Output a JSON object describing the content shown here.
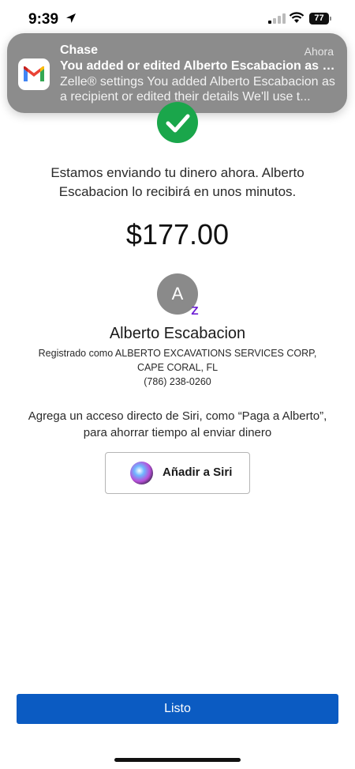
{
  "status_bar": {
    "time": "9:39",
    "battery": "77"
  },
  "notification": {
    "app": "Chase",
    "time": "Ahora",
    "title": "You added or edited Alberto Escabacion as a...",
    "body": "Zelle® settings You added Alberto Escabacion as a recipient or edited their details We'll use t..."
  },
  "confirmation": {
    "message": "Estamos enviando tu dinero ahora. Alberto Escabacion lo recibirá en unos minutos.",
    "amount": "$177.00"
  },
  "recipient": {
    "avatar_letter": "A",
    "badge": "Z",
    "name": "Alberto Escabacion",
    "registered_line1": "Registrado como ALBERTO EXCAVATIONS SERVICES CORP,",
    "registered_line2": "CAPE CORAL, FL",
    "phone": "(786) 238-0260"
  },
  "siri": {
    "prompt": "Agrega un acceso directo de Siri, como “Paga a Alberto”, para ahorrar tiempo al enviar dinero",
    "button_label": "Añadir a Siri"
  },
  "footer": {
    "done_label": "Listo"
  },
  "colors": {
    "accent": "#0b5bc2",
    "success": "#1aa64b",
    "zelle": "#6d1ed4"
  }
}
